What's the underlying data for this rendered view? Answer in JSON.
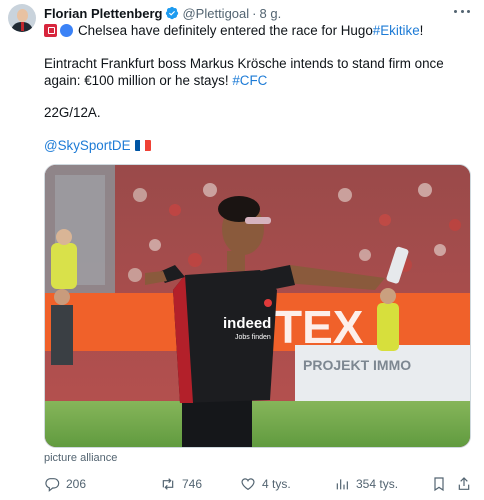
{
  "author": {
    "name": "Florian Plettenberg",
    "handle": "@Plettigoal",
    "separator": "·",
    "time": "8 g."
  },
  "tweet": {
    "line1_text": "Chelsea have definitely entered the race for Hugo ",
    "line1_hashtag": "#Ekitike",
    "line1_end": "!",
    "line2_text": "Eintracht Frankfurt boss Markus Krösche intends to stand firm once again: €100 million or he stays! ",
    "line2_hashtag": "#CFC",
    "line3": "22G/12A.",
    "source_mention": "@SkySportDE"
  },
  "media": {
    "credit": "picture alliance",
    "banner_text": "GUTEX",
    "adboard_text": "PROJEKT IMMO",
    "shirt_sponsor": "indeed",
    "shirt_sponsor_sub": "Jobs finden"
  },
  "actions": {
    "replies": "206",
    "retweets": "746",
    "likes": "4 tys.",
    "views": "354 tys."
  },
  "colors": {
    "link": "#1d7bd6",
    "muted": "#536471",
    "verified": "#1d9bf0",
    "france_blue": "#0055a4",
    "france_red": "#ef4135"
  }
}
